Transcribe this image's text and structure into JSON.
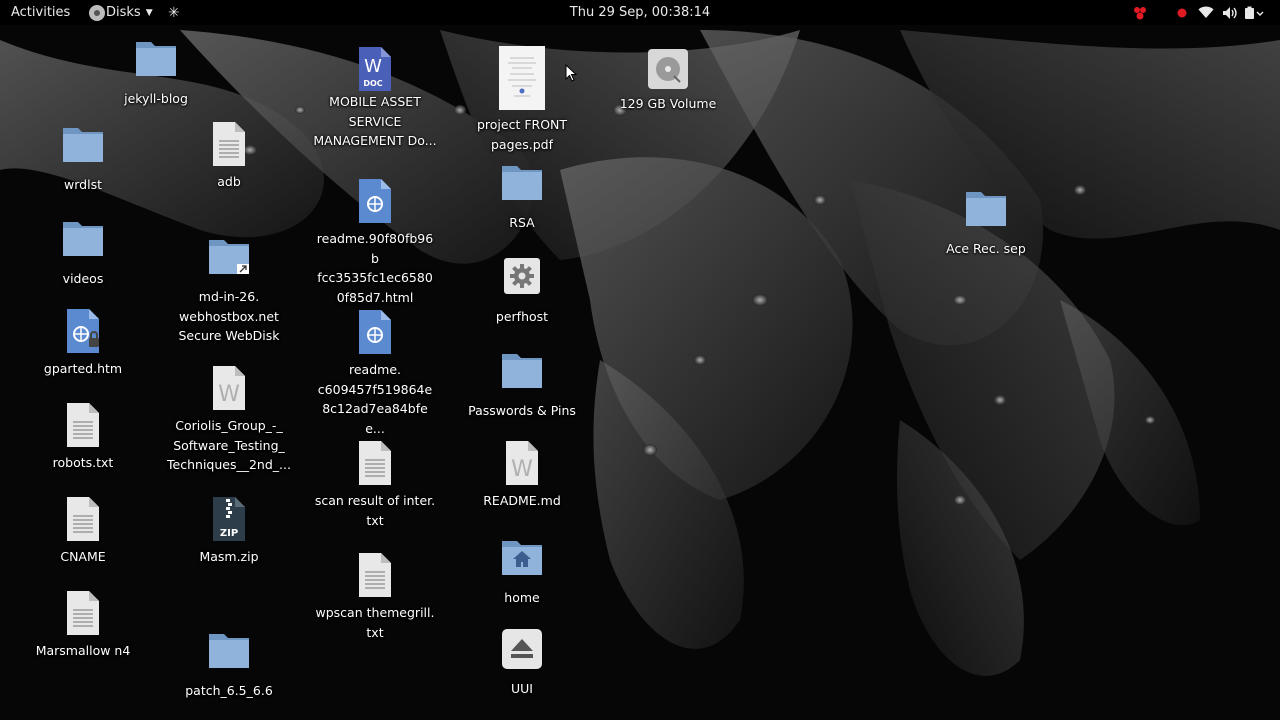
{
  "topbar": {
    "activities": "Activities",
    "app_menu": "Disks",
    "clock": "Thu 29 Sep, 00:38:14"
  },
  "colors": {
    "folder": "#8fb3da",
    "folder_dark": "#6f95c2",
    "doc_blue": "#4a5fb8",
    "tray_red": "#e01b24"
  },
  "desktop_icons": {
    "jekyll_blog": "jekyll-blog",
    "wrdlst": "wrdlst",
    "videos": "videos",
    "gparted": "gparted.htm",
    "robots": "robots.txt",
    "cname": "CNAME",
    "marsmallow": "Marsmallow n4",
    "adb": "adb",
    "webdisk": "md-in-26.\nwebhostbox.net\nSecure WebDisk",
    "coriolis": "Coriolis_Group_-_\nSoftware_Testing_\nTechniques__2nd_...",
    "masm": "Masm.zip",
    "patch": "patch_6.5_6.6",
    "mobile_asset": "MOBILE ASSET\nSERVICE\nMANAGEMENT Do...",
    "readme_html": "readme.90f80fb96b\nfcc3535fc1ec6580\n0f85d7.html",
    "readme_c609": "readme.\nc609457f519864e\n8c12ad7ea84bfee...",
    "scan_result": "scan result of inter.\ntxt",
    "wpscan": "wpscan themegrill.\ntxt",
    "project_front": "project FRONT\npages.pdf",
    "rsa": "RSA",
    "perfhost": "perfhost",
    "passwords": "Passwords & Pins",
    "readme_md": "README.md",
    "home": "home",
    "uui": "UUI",
    "volume": "129 GB Volume",
    "ace_rec": "Ace Rec. sep"
  },
  "icon_badges": {
    "doc": "DOC",
    "zip": "ZIP",
    "word": "W"
  }
}
